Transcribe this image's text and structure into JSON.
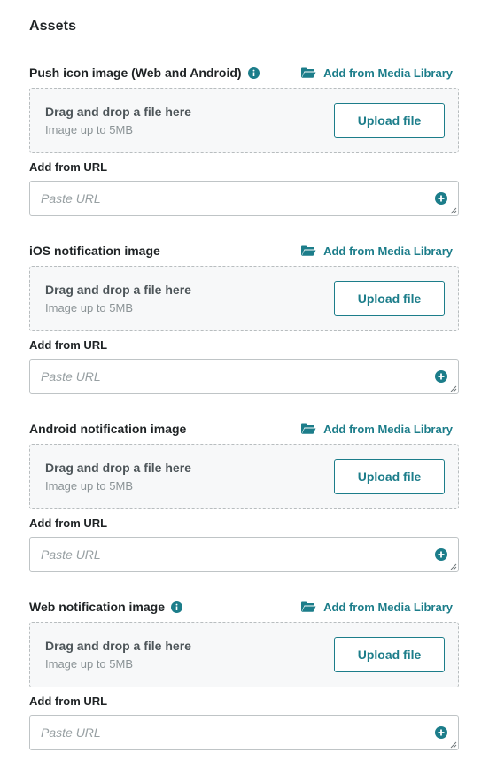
{
  "page": {
    "heading": "Assets"
  },
  "colors": {
    "accent": "#1c7d8a",
    "text": "#1f2325",
    "muted": "#8b9396"
  },
  "sections": [
    {
      "label": "Push icon image (Web and Android)",
      "has_info": true,
      "media_link": "Add from Media Library",
      "dropzone_title": "Drag and drop a file here",
      "dropzone_sub": "Image up to 5MB",
      "upload_label": "Upload file",
      "url_label": "Add from URL",
      "url_placeholder": "Paste URL",
      "url_value": ""
    },
    {
      "label": "iOS notification image",
      "has_info": false,
      "media_link": "Add from Media Library",
      "dropzone_title": "Drag and drop a file here",
      "dropzone_sub": "Image up to 5MB",
      "upload_label": "Upload file",
      "url_label": "Add from URL",
      "url_placeholder": "Paste URL",
      "url_value": ""
    },
    {
      "label": "Android notification image",
      "has_info": false,
      "media_link": "Add from Media Library",
      "dropzone_title": "Drag and drop a file here",
      "dropzone_sub": "Image up to 5MB",
      "upload_label": "Upload file",
      "url_label": "Add from URL",
      "url_placeholder": "Paste URL",
      "url_value": ""
    },
    {
      "label": "Web notification image",
      "has_info": true,
      "media_link": "Add from Media Library",
      "dropzone_title": "Drag and drop a file here",
      "dropzone_sub": "Image up to 5MB",
      "upload_label": "Upload file",
      "url_label": "Add from URL",
      "url_placeholder": "Paste URL",
      "url_value": ""
    }
  ],
  "icons": {
    "info": "info-icon",
    "folder": "folder-open-icon",
    "add": "plus-circle-icon",
    "resize": "resize-handle-icon"
  }
}
